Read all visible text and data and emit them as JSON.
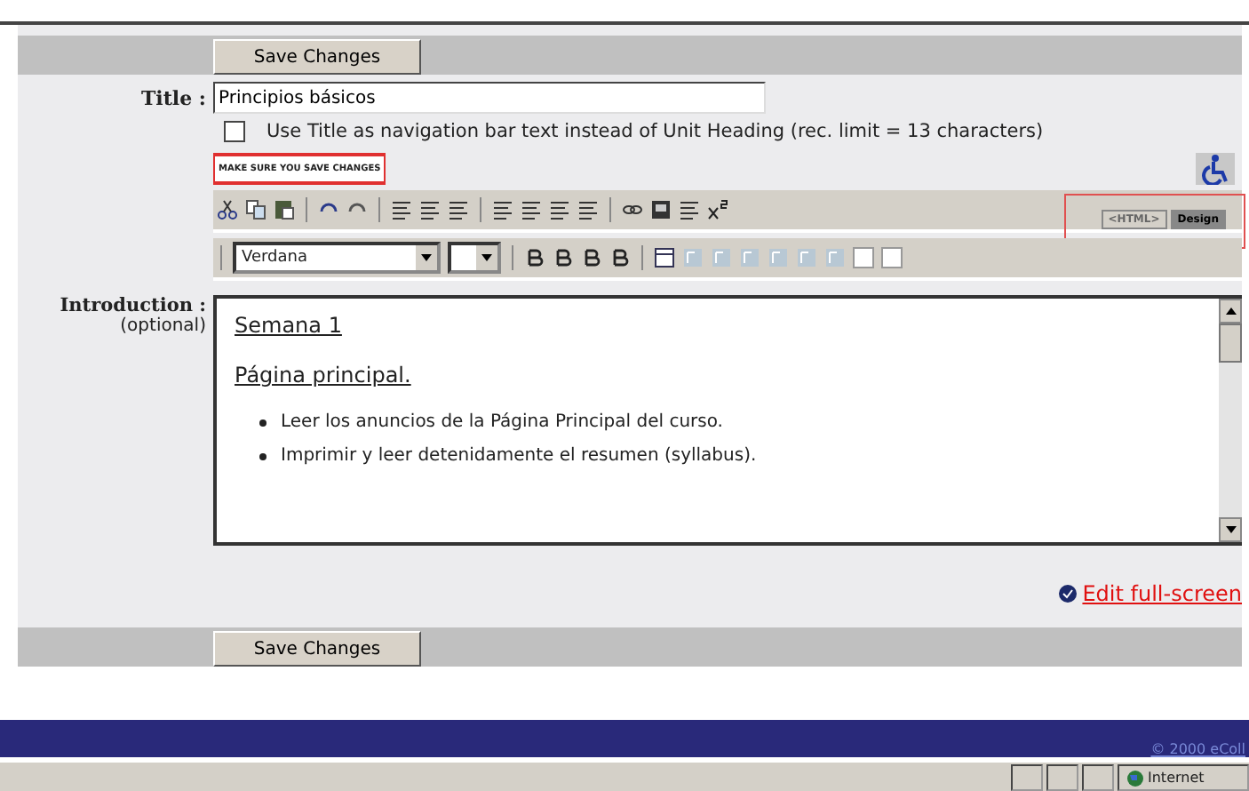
{
  "top_save_button": "Save Changes",
  "title_field": {
    "label": "Title :",
    "value": "Principios básicos"
  },
  "nav_checkbox": {
    "label": "Use Title as navigation bar text instead of Unit Heading (rec. limit = 13 characters)",
    "checked": false
  },
  "warning": "MAKE SURE YOU SAVE CHANGES",
  "mode_tabs": [
    {
      "label": "<HTML>",
      "selected": false
    },
    {
      "label": "Design",
      "selected": true
    }
  ],
  "font_select": "Verdana",
  "introduction": {
    "label": "Introduction :",
    "hint": "(optional)",
    "heading": "Semana 1",
    "subheading": "Página principal.",
    "bullets": [
      "Leer los anuncios de la Página Principal del curso.",
      "Imprimir y leer detenidamente el resumen (syllabus)."
    ]
  },
  "edit_full_screen": "Edit full-screen",
  "bottom_save_button": "Save Changes",
  "footer": "© 2000 eColl",
  "status_bar": {
    "zone": "Internet"
  }
}
